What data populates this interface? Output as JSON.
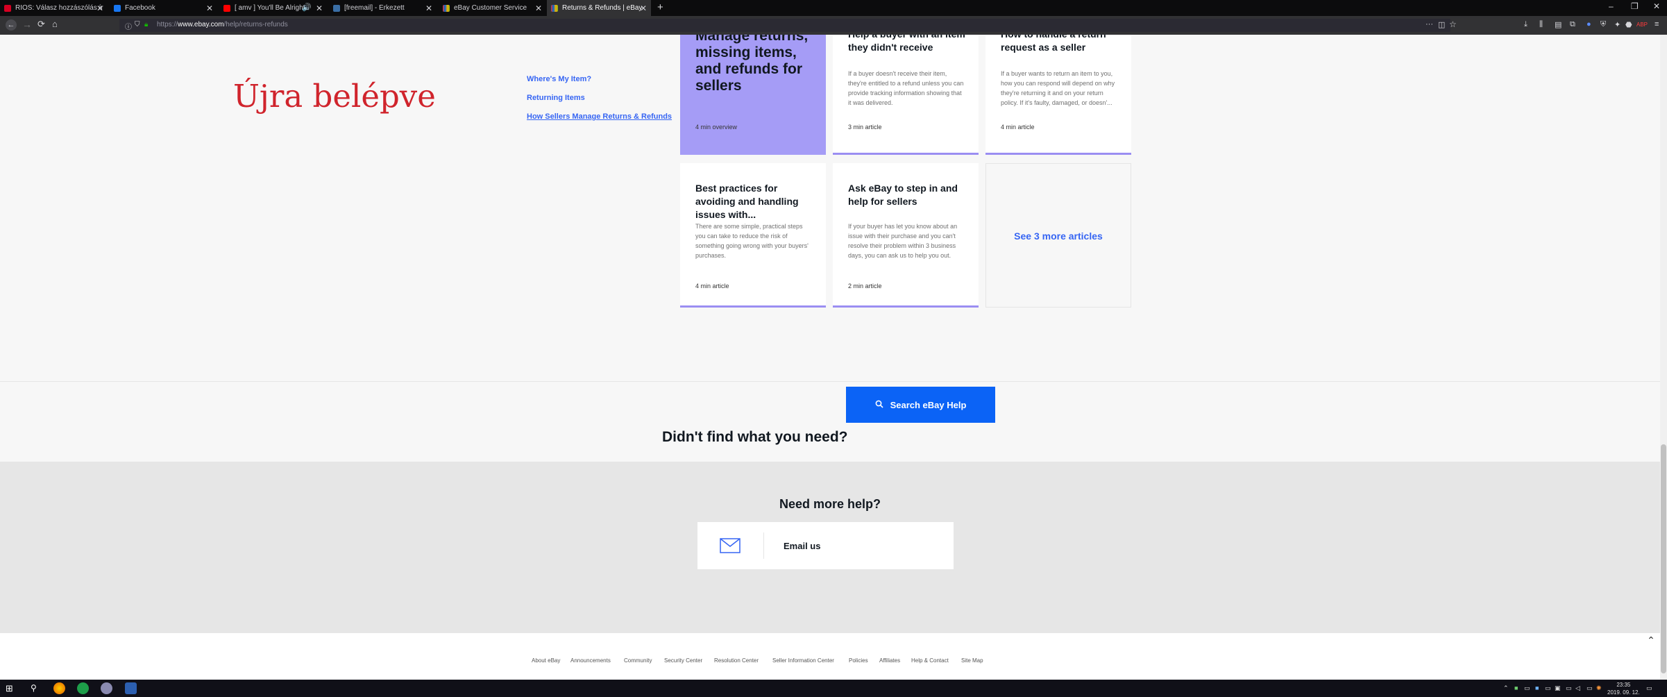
{
  "browser": {
    "tabs": [
      {
        "label": "RIOS: Válasz hozzászólás írása",
        "fav_color": "#d70022"
      },
      {
        "label": "Facebook",
        "fav_color": "#1877f2"
      },
      {
        "label": "[ amv ] You'll Be Alright - Y",
        "fav_color": "#ff0000"
      },
      {
        "label": "[freemail] - Érkezett",
        "fav_color": "#3a6ea5"
      },
      {
        "label": "eBay Customer Service",
        "fav_color": "#e53238"
      },
      {
        "label": "Returns & Refunds | eBay",
        "fav_color": "#e53238"
      }
    ],
    "new_tab": "+",
    "url_prefix": "https://",
    "url_host": "www.ebay.com",
    "url_path": "/help/returns-refunds"
  },
  "overlay_text": "Újra belépve",
  "sidebar": {
    "links": [
      {
        "label": "Where's My Item?"
      },
      {
        "label": "Returning Items"
      },
      {
        "label": "How Sellers Manage Returns & Refunds"
      }
    ]
  },
  "cards": [
    {
      "title": "Manage returns, missing items, and refunds for sellers",
      "desc": "",
      "meta": "4 min overview"
    },
    {
      "title": "Help a buyer with an item they didn't receive",
      "desc": "If a buyer doesn't receive their item, they're entitled to a refund unless you can provide tracking information showing that it was delivered.",
      "meta": "3 min article"
    },
    {
      "title": "How to handle a return request as a seller",
      "desc": "If a buyer wants to return an item to you, how you can respond will depend on why they're returning it and on your return policy. If it's faulty, damaged, or doesn'...",
      "meta": "4 min article"
    },
    {
      "title": "Best practices for avoiding and handling issues with...",
      "desc": "There are some simple, practical steps you can take to reduce the risk of something going wrong with your buyers' purchases.",
      "meta": "4 min article"
    },
    {
      "title": "Ask eBay to step in and help for sellers",
      "desc": "If your buyer has let you know about an issue with their purchase and you can't resolve their problem within 3 business days, you can ask us to help you out.",
      "meta": "2 min article"
    }
  ],
  "more_articles": "See 3 more articles",
  "didnt_find": "Didn't find what you need?",
  "search_button": "Search eBay Help",
  "need_more_help": "Need more help?",
  "email_us": "Email us",
  "footer_links": [
    "About eBay",
    "Announcements",
    "Community",
    "Security Center",
    "Resolution Center",
    "Seller Information Center",
    "Policies",
    "Affiliates",
    "Help & Contact",
    "Site Map"
  ],
  "clock": {
    "time": "23:35",
    "date": "2019. 09. 12."
  }
}
